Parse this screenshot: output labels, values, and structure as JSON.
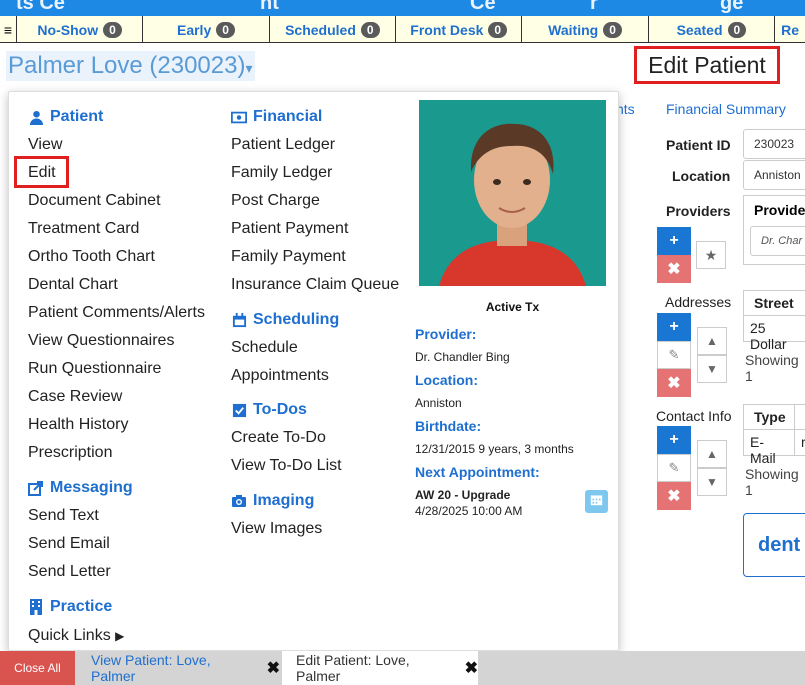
{
  "header": {
    "fragments": [
      "ts Ce",
      "nt",
      "Ce",
      "r",
      "ge"
    ]
  },
  "status_tabs": [
    {
      "label": "No-Show",
      "count": "0"
    },
    {
      "label": "Early",
      "count": "0"
    },
    {
      "label": "Scheduled",
      "count": "0"
    },
    {
      "label": "Front Desk",
      "count": "0"
    },
    {
      "label": "Waiting",
      "count": "0"
    },
    {
      "label": "Seated",
      "count": "0"
    },
    {
      "label": "Re"
    }
  ],
  "patient_title": "Palmer Love (230023)",
  "page_heading": "Edit Patient",
  "menu": {
    "patient": {
      "title": "Patient",
      "items": [
        "View",
        "Edit",
        "Document Cabinet",
        "Treatment Card",
        "Ortho Tooth Chart",
        "Dental Chart",
        "Patient Comments/Alerts",
        "View Questionnaires",
        "Run Questionnaire",
        "Case Review",
        "Health History",
        "Prescription"
      ]
    },
    "messaging": {
      "title": "Messaging",
      "items": [
        "Send Text",
        "Send Email",
        "Send Letter"
      ]
    },
    "practice": {
      "title": "Practice",
      "items": [
        "Quick Links"
      ]
    },
    "financial": {
      "title": "Financial",
      "items": [
        "Patient Ledger",
        "Family Ledger",
        "Post Charge",
        "Patient Payment",
        "Family Payment",
        "Insurance Claim Queue"
      ]
    },
    "scheduling": {
      "title": "Scheduling",
      "items": [
        "Schedule",
        "Appointments"
      ]
    },
    "todos": {
      "title": "To-Dos",
      "items": [
        "Create To-Do",
        "View To-Do List"
      ]
    },
    "imaging": {
      "title": "Imaging",
      "items": [
        "View Images"
      ]
    }
  },
  "patient_info": {
    "status": "Active Tx",
    "provider_label": "Provider:",
    "provider": "Dr. Chandler Bing",
    "location_label": "Location:",
    "location": "Anniston",
    "birthdate_label": "Birthdate:",
    "birthdate": "12/31/2015 9 years, 3 months",
    "next_appt_label": "Next Appointment:",
    "next_appt_type": "AW 20 - Upgrade",
    "next_appt_time": "4/28/2025 10:00 AM"
  },
  "form": {
    "link_partial": "nts",
    "financial_summary": "Financial Summary",
    "patient_id_label": "Patient ID",
    "patient_id": "230023",
    "location_label": "Location",
    "location": "Anniston",
    "providers_label": "Providers",
    "providers_col": "Provider",
    "providers_value": "Dr. Char",
    "addresses_label": "Addresses",
    "street_col": "Street",
    "street_value": "25 Dollar",
    "showing": "Showing 1",
    "contact_label": "Contact Info",
    "type_col": "Type",
    "type_value": "E-Mail",
    "type_value2": "r",
    "dent_label": "dent"
  },
  "bottom_tabs": {
    "close_all": "Close All",
    "view_tab": "View Patient: Love, Palmer",
    "edit_tab": "Edit Patient: Love, Palmer"
  },
  "colors": {
    "accent_blue": "#1e6fcf",
    "highlight_red": "#e02020",
    "photo_bg": "#1a9a8e"
  }
}
